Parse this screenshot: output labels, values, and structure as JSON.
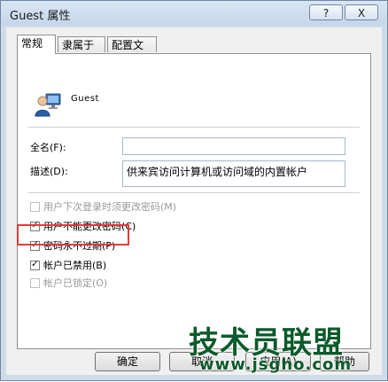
{
  "window": {
    "title": "Guest 属性",
    "help_label": "?",
    "close_label": "X"
  },
  "tabs": [
    {
      "label": "常规",
      "active": true
    },
    {
      "label": "隶属于",
      "active": false
    },
    {
      "label": "配置文件",
      "active": false
    }
  ],
  "user": {
    "name": "Guest"
  },
  "fields": {
    "fullname_label": "全名(F):",
    "fullname_value": "",
    "description_label": "描述(D):",
    "description_value": "供来宾访问计算机或访问域的内置帐户"
  },
  "options": [
    {
      "label": "用户下次登录时须更改密码(M)",
      "checked": false,
      "disabled": true
    },
    {
      "label": "用户不能更改密码(C)",
      "checked": true,
      "disabled": false
    },
    {
      "label": "密码永不过期(P)",
      "checked": true,
      "disabled": false
    },
    {
      "label": "帐户已禁用(B)",
      "checked": true,
      "disabled": false
    },
    {
      "label": "帐户已锁定(O)",
      "checked": false,
      "disabled": true
    }
  ],
  "buttons": {
    "ok": "确定",
    "cancel": "取消",
    "apply": "应用(A)",
    "help": "帮助"
  },
  "watermark": {
    "main": "技术员联盟",
    "url": "www.jsgho.com"
  },
  "colors": {
    "highlight": "#e43a3a",
    "watermark": "#0a5a2a"
  }
}
